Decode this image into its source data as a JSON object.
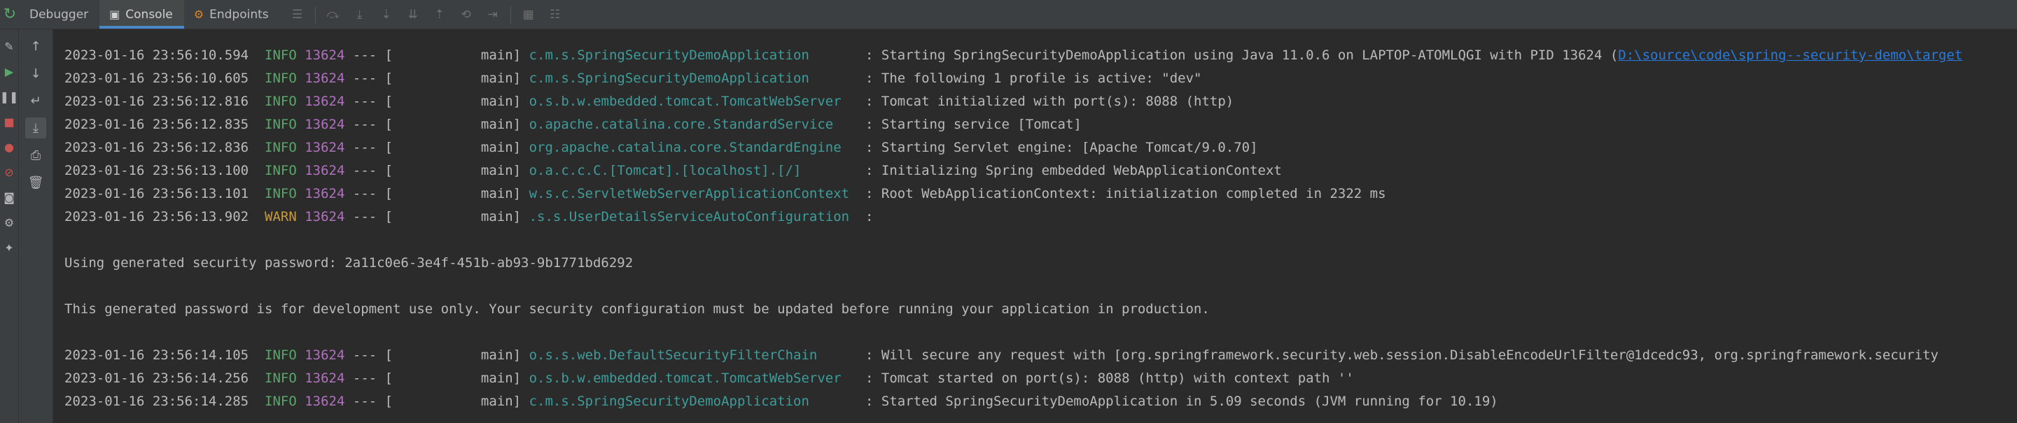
{
  "tabs": [
    {
      "label": "Debugger",
      "icon": "debugger-icon"
    },
    {
      "label": "Console",
      "icon": "console-icon"
    },
    {
      "label": "Endpoints",
      "icon": "endpoints-icon"
    }
  ],
  "console_lines": [
    {
      "ts": "2023-01-16 23:56:10.594",
      "level": "INFO",
      "pid": "13624",
      "sep": "--- [",
      "thread": "           main]",
      "logger": "c.m.s.SpringSecurityDemoApplication      ",
      "msg": ": Starting SpringSecurityDemoApplication using Java 11.0.6 on LAPTOP-ATOMLQGI with PID 13624 (",
      "link": "D:\\source\\code\\spring--security-demo\\target"
    },
    {
      "ts": "2023-01-16 23:56:10.605",
      "level": "INFO",
      "pid": "13624",
      "sep": "--- [",
      "thread": "           main]",
      "logger": "c.m.s.SpringSecurityDemoApplication      ",
      "msg": ": The following 1 profile is active: \"dev\""
    },
    {
      "ts": "2023-01-16 23:56:12.816",
      "level": "INFO",
      "pid": "13624",
      "sep": "--- [",
      "thread": "           main]",
      "logger": "o.s.b.w.embedded.tomcat.TomcatWebServer  ",
      "msg": ": Tomcat initialized with port(s): 8088 (http)"
    },
    {
      "ts": "2023-01-16 23:56:12.835",
      "level": "INFO",
      "pid": "13624",
      "sep": "--- [",
      "thread": "           main]",
      "logger": "o.apache.catalina.core.StandardService   ",
      "msg": ": Starting service [Tomcat]"
    },
    {
      "ts": "2023-01-16 23:56:12.836",
      "level": "INFO",
      "pid": "13624",
      "sep": "--- [",
      "thread": "           main]",
      "logger": "org.apache.catalina.core.StandardEngine  ",
      "msg": ": Starting Servlet engine: [Apache Tomcat/9.0.70]"
    },
    {
      "ts": "2023-01-16 23:56:13.100",
      "level": "INFO",
      "pid": "13624",
      "sep": "--- [",
      "thread": "           main]",
      "logger": "o.a.c.c.C.[Tomcat].[localhost].[/]       ",
      "msg": ": Initializing Spring embedded WebApplicationContext"
    },
    {
      "ts": "2023-01-16 23:56:13.101",
      "level": "INFO",
      "pid": "13624",
      "sep": "--- [",
      "thread": "           main]",
      "logger": "w.s.c.ServletWebServerApplicationContext ",
      "msg": ": Root WebApplicationContext: initialization completed in 2322 ms"
    },
    {
      "ts": "2023-01-16 23:56:13.902",
      "level": "WARN",
      "pid": "13624",
      "sep": "--- [",
      "thread": "           main]",
      "logger": ".s.s.UserDetailsServiceAutoConfiguration ",
      "msg": ":"
    },
    {
      "text": ""
    },
    {
      "text": "Using generated security password: 2a11c0e6-3e4f-451b-ab93-9b1771bd6292"
    },
    {
      "text": ""
    },
    {
      "text": "This generated password is for development use only. Your security configuration must be updated before running your application in production."
    },
    {
      "text": ""
    },
    {
      "ts": "2023-01-16 23:56:14.105",
      "level": "INFO",
      "pid": "13624",
      "sep": "--- [",
      "thread": "           main]",
      "logger": "o.s.s.web.DefaultSecurityFilterChain     ",
      "msg": ": Will secure any request with [org.springframework.security.web.session.DisableEncodeUrlFilter@1dcedc93, org.springframework.security"
    },
    {
      "ts": "2023-01-16 23:56:14.256",
      "level": "INFO",
      "pid": "13624",
      "sep": "--- [",
      "thread": "           main]",
      "logger": "o.s.b.w.embedded.tomcat.TomcatWebServer  ",
      "msg": ": Tomcat started on port(s): 8088 (http) with context path ''"
    },
    {
      "ts": "2023-01-16 23:56:14.285",
      "level": "INFO",
      "pid": "13624",
      "sep": "--- [",
      "thread": "           main]",
      "logger": "c.m.s.SpringSecurityDemoApplication      ",
      "msg": ": Started SpringSecurityDemoApplication in 5.09 seconds (JVM running for 10.19)"
    }
  ]
}
